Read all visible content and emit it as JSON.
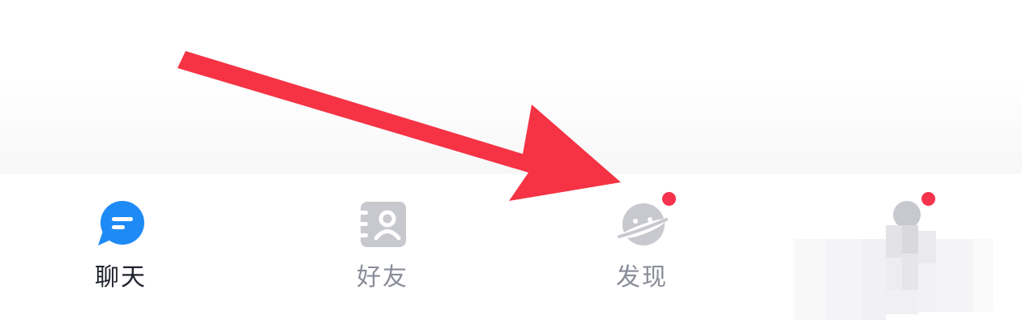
{
  "tabbar": {
    "tabs": [
      {
        "label": "聊天",
        "icon": "chat-bubble-icon",
        "active": true
      },
      {
        "label": "好友",
        "icon": "contacts-book-icon",
        "active": false
      },
      {
        "label": "发现",
        "icon": "planet-icon",
        "active": false,
        "badge": true
      },
      {
        "label": "",
        "icon": "profile-icon",
        "active": false,
        "badge": true,
        "obscured": true
      }
    ]
  },
  "colors": {
    "accent": "#1e8bf5",
    "badge": "#f5334d",
    "arrow": "#f53345",
    "inactive_icon": "#c8c9ce",
    "active_label": "#20222e",
    "inactive_label": "#8a8d99"
  }
}
